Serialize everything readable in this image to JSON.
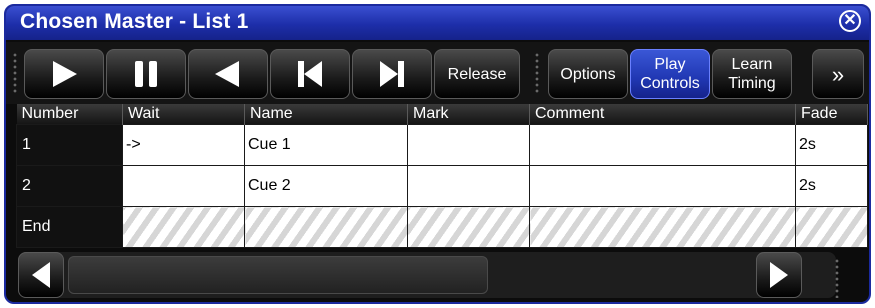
{
  "window": {
    "title": "Chosen Master - List 1",
    "close_icon": "close-circle-icon"
  },
  "toolbar": {
    "play_icon": "play-icon",
    "pause_icon": "pause-icon",
    "back_icon": "back-icon",
    "skip_back_icon": "skip-back-icon",
    "skip_forward_icon": "skip-forward-icon",
    "release_label": "Release",
    "options_label": "Options",
    "play_controls_label_1": "Play",
    "play_controls_label_2": "Controls",
    "learn_timing_label_1": "Learn",
    "learn_timing_label_2": "Timing",
    "more_label": "»"
  },
  "table": {
    "columns": [
      "Number",
      "Wait",
      "Name",
      "Mark",
      "Comment",
      "Fade"
    ],
    "rows": [
      {
        "number": "1",
        "wait": "->",
        "name": "Cue 1",
        "mark": "",
        "comment": "",
        "fade": "2s"
      },
      {
        "number": "2",
        "wait": "",
        "name": "Cue 2",
        "mark": "",
        "comment": "",
        "fade": "2s"
      },
      {
        "number": "End",
        "wait": "",
        "name": "",
        "mark": "",
        "comment": "",
        "fade": ""
      }
    ]
  },
  "scrollbar": {
    "left_icon": "scroll-left-icon",
    "right_icon": "scroll-right-icon"
  },
  "colors": {
    "title_blue": "#1d2ea9",
    "active_button": "#2037b3",
    "grid_bg": "#ffffff"
  }
}
